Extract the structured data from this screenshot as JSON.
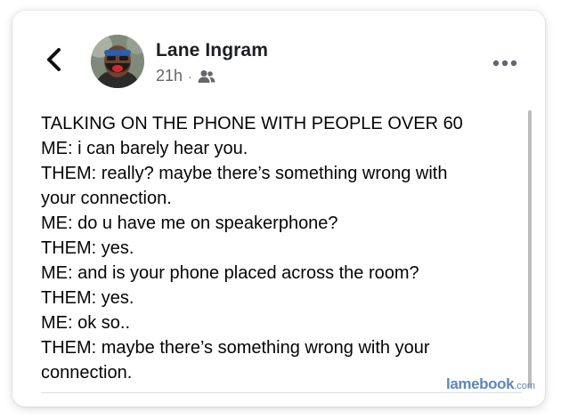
{
  "header": {
    "back_icon": "chevron-left-icon",
    "author_name": "Lane Ingram",
    "timestamp": "21h",
    "separator": "·",
    "audience_icon": "friends-icon",
    "more_icon": "more-horizontal-icon"
  },
  "post": {
    "lines": [
      "TALKING ON THE PHONE WITH PEOPLE OVER 60",
      "ME: i can barely hear you.",
      "THEM: really? maybe there’s something wrong with",
      "your connection.",
      "ME: do u have me on speakerphone?",
      "THEM: yes.",
      "ME: and is your phone placed across the room?",
      "THEM: yes.",
      "ME: ok so..",
      "THEM: maybe there’s something wrong with your",
      "connection."
    ]
  },
  "watermark": {
    "main": "lamebook",
    "suffix": ".com"
  },
  "colors": {
    "text_primary": "#050505",
    "text_secondary": "#65676b",
    "watermark": "#5e87b7"
  }
}
